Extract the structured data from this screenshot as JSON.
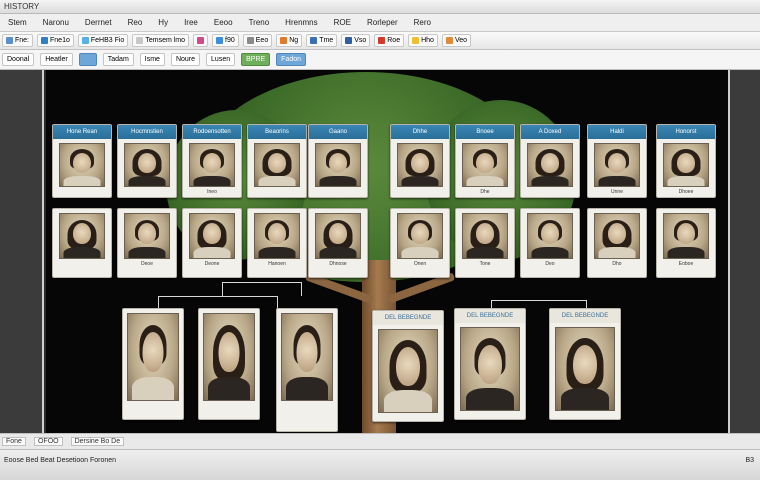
{
  "window": {
    "title": "HISTORY"
  },
  "menu": [
    "Stem",
    "Naronu",
    "Derrnet",
    "Reo",
    "Hy",
    "Iree",
    "Eeoo",
    "Treno",
    "Hrenmns",
    "ROE",
    "Rorleper",
    "Rero"
  ],
  "toolbar1": [
    {
      "label": "Fne:",
      "swatch": "#5a8fd0"
    },
    {
      "label": "Fne1o",
      "swatch": "#2f7fc5"
    },
    {
      "label": "FeHB3 Fio",
      "swatch": "#58b0e8"
    },
    {
      "label": "Temsem lmo",
      "swatch": "#c8c8c8"
    },
    {
      "label": "",
      "swatch": "#d04a8c"
    },
    {
      "label": "f90",
      "swatch": "#3e8ede"
    },
    {
      "label": "Eeo",
      "swatch": "#8a8a8a"
    },
    {
      "label": "Ng",
      "swatch": "#e27a2b"
    },
    {
      "label": "Tme",
      "swatch": "#3a6fb8"
    },
    {
      "label": "Vso",
      "swatch": "#2e5fa3"
    },
    {
      "label": "Roe",
      "swatch": "#d23a2a"
    },
    {
      "label": "Hho",
      "swatch": "#f0c030"
    },
    {
      "label": "Veo",
      "swatch": "#e08a3a"
    }
  ],
  "toolbar2": [
    {
      "label": "Doonal",
      "style": ""
    },
    {
      "label": "Heatler",
      "style": ""
    },
    {
      "label": "",
      "style": "blue"
    },
    {
      "label": "Tadam",
      "style": ""
    },
    {
      "label": "Isme",
      "style": ""
    },
    {
      "label": "Noure",
      "style": ""
    },
    {
      "label": "Lusen",
      "style": ""
    },
    {
      "label": "BPRE",
      "style": "green"
    },
    {
      "label": "Fadon",
      "style": "blue"
    }
  ],
  "tree": {
    "row1": [
      {
        "header": "Hone Rean",
        "caption": ""
      },
      {
        "header": "Hocmnstien",
        "caption": ""
      },
      {
        "header": "Rodoensotten",
        "caption": "Ineo"
      },
      {
        "header": "Beaorins",
        "caption": ""
      },
      {
        "header": "Gaano",
        "caption": ""
      },
      {
        "header": "Dhhe",
        "caption": ""
      },
      {
        "header": "Bnoee",
        "caption": "Dhe"
      },
      {
        "header": "A Doxed",
        "caption": ""
      },
      {
        "header": "Haldi",
        "caption": "Unne"
      },
      {
        "header": "Honorst",
        "caption": "Dhoee"
      }
    ],
    "row2": [
      {
        "caption": ""
      },
      {
        "caption": "Deoe"
      },
      {
        "caption": "Deone"
      },
      {
        "caption": "Hanoen"
      },
      {
        "caption": "Dhnose"
      },
      {
        "caption": "Onen"
      },
      {
        "caption": "Tone"
      },
      {
        "caption": "Deo"
      },
      {
        "caption": "Dho"
      },
      {
        "caption": "Eoboe"
      }
    ],
    "parents": [
      {
        "caption": ""
      },
      {
        "caption": ""
      },
      {
        "caption": ""
      },
      {
        "caption": ""
      },
      {
        "caption": ""
      },
      {
        "caption": ""
      }
    ],
    "parent_header": "DEL BEBEGNDE"
  },
  "status": {
    "left": "Fone",
    "tabs": [
      "OFOO",
      "Dersine Bo De"
    ],
    "bottom_left": "Eoose Bed Beat Desetioon Foronen",
    "bottom_right": "B3"
  }
}
